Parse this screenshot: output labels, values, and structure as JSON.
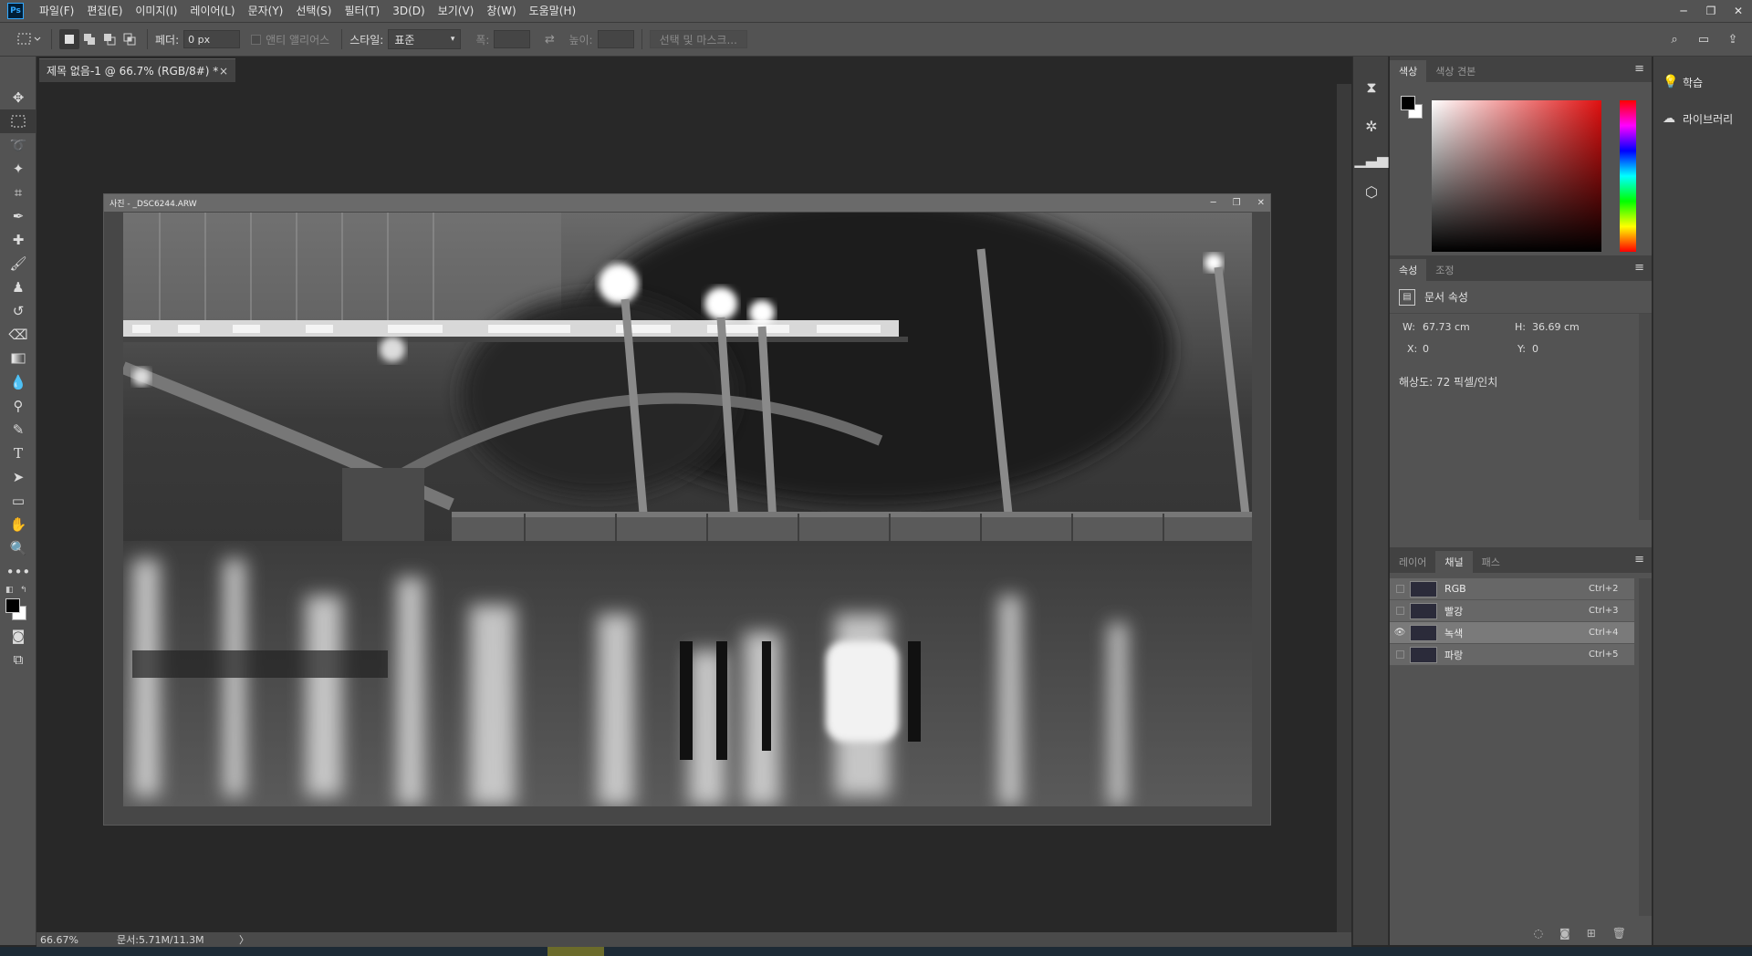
{
  "menubar": {
    "logo": "Ps",
    "items": [
      "파일(F)",
      "편집(E)",
      "이미지(I)",
      "레이어(L)",
      "문자(Y)",
      "선택(S)",
      "필터(T)",
      "3D(D)",
      "보기(V)",
      "창(W)",
      "도움말(H)"
    ],
    "minimize": "─",
    "restore": "❐",
    "close": "✕"
  },
  "options": {
    "feather_label": "페더:",
    "feather_value": "0 px",
    "antialias_label": "앤티 앨리어스",
    "style_label": "스타일:",
    "style_value": "표준",
    "width_label": "폭:",
    "height_label": "높이:",
    "select_mask_label": "선택 및 마스크..."
  },
  "document": {
    "tab_title": "제목 없음-1 @ 66.7% (RGB/8#) *",
    "tab_close": "×",
    "float_title": "사진 - _DSC6244.ARW",
    "float_min": "─",
    "float_restore": "❐",
    "float_close": "✕"
  },
  "statusbar": {
    "zoom": "66.67%",
    "doc_info": "문서:5.71M/11.3M",
    "arrow": "〉"
  },
  "color_panel": {
    "tabs": [
      "색상",
      "색상 견본"
    ],
    "foreground": "#000000",
    "background": "#ffffff",
    "hue_color": "#e01010"
  },
  "properties_panel": {
    "tabs": [
      "속성",
      "조정"
    ],
    "section_title": "문서 속성",
    "w_label": "W:",
    "w_value": "67.73 cm",
    "h_label": "H:",
    "h_value": "36.69 cm",
    "x_label": "X:",
    "x_value": "0",
    "y_label": "Y:",
    "y_value": "0",
    "resolution": "해상도: 72 픽셀/인치"
  },
  "channels_panel": {
    "tabs": [
      "레이어",
      "채널",
      "패스"
    ],
    "rows": [
      {
        "name": "RGB",
        "shortcut": "Ctrl+2",
        "visible": false
      },
      {
        "name": "빨강",
        "shortcut": "Ctrl+3",
        "visible": false
      },
      {
        "name": "녹색",
        "shortcut": "Ctrl+4",
        "visible": true
      },
      {
        "name": "파랑",
        "shortcut": "Ctrl+5",
        "visible": false
      }
    ]
  },
  "learn_panel": {
    "learn": "학습",
    "libraries": "라이브러리"
  },
  "colors": {
    "ui_dark": "#282828",
    "ui_mid": "#535353",
    "accent": "#31a8ff"
  }
}
